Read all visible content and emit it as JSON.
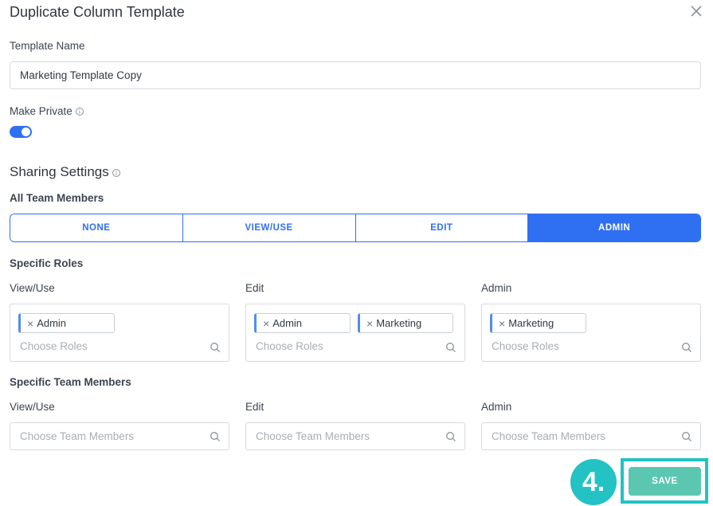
{
  "dialog": {
    "title": "Duplicate Column Template"
  },
  "template_name": {
    "label": "Template Name",
    "value": "Marketing Template Copy"
  },
  "make_private": {
    "label": "Make Private",
    "on": true
  },
  "sharing": {
    "title": "Sharing Settings",
    "all_team_members_label": "All Team Members",
    "options": [
      "NONE",
      "VIEW/USE",
      "EDIT",
      "ADMIN"
    ],
    "selected": "ADMIN"
  },
  "specific_roles": {
    "title": "Specific Roles",
    "columns": [
      {
        "label": "View/Use",
        "tags": [
          "Admin"
        ],
        "placeholder": "Choose Roles"
      },
      {
        "label": "Edit",
        "tags": [
          "Admin",
          "Marketing"
        ],
        "placeholder": "Choose Roles"
      },
      {
        "label": "Admin",
        "tags": [
          "Marketing"
        ],
        "placeholder": "Choose Roles"
      }
    ]
  },
  "specific_team_members": {
    "title": "Specific Team Members",
    "columns": [
      {
        "label": "View/Use",
        "placeholder": "Choose Team Members"
      },
      {
        "label": "Edit",
        "placeholder": "Choose Team Members"
      },
      {
        "label": "Admin",
        "placeholder": "Choose Team Members"
      }
    ]
  },
  "step_badge": "4.",
  "save_label": "SAVE",
  "colors": {
    "primary": "#2f6ff2",
    "save": "#5cc7b1",
    "highlight": "#23c2c4"
  }
}
